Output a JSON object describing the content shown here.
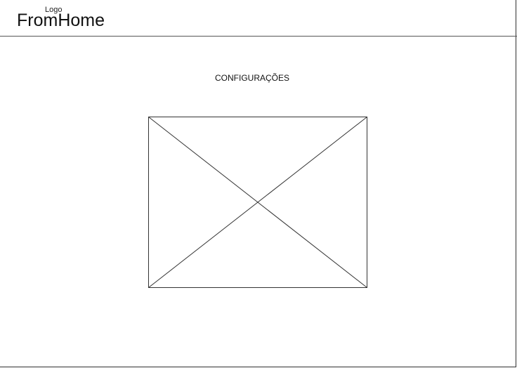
{
  "header": {
    "logo_caption": "Logo",
    "logo_text": "FromHome"
  },
  "main": {
    "title": "CONFIGURAÇÕES"
  },
  "colors": {
    "stroke": "#333333",
    "background": "#ffffff"
  }
}
